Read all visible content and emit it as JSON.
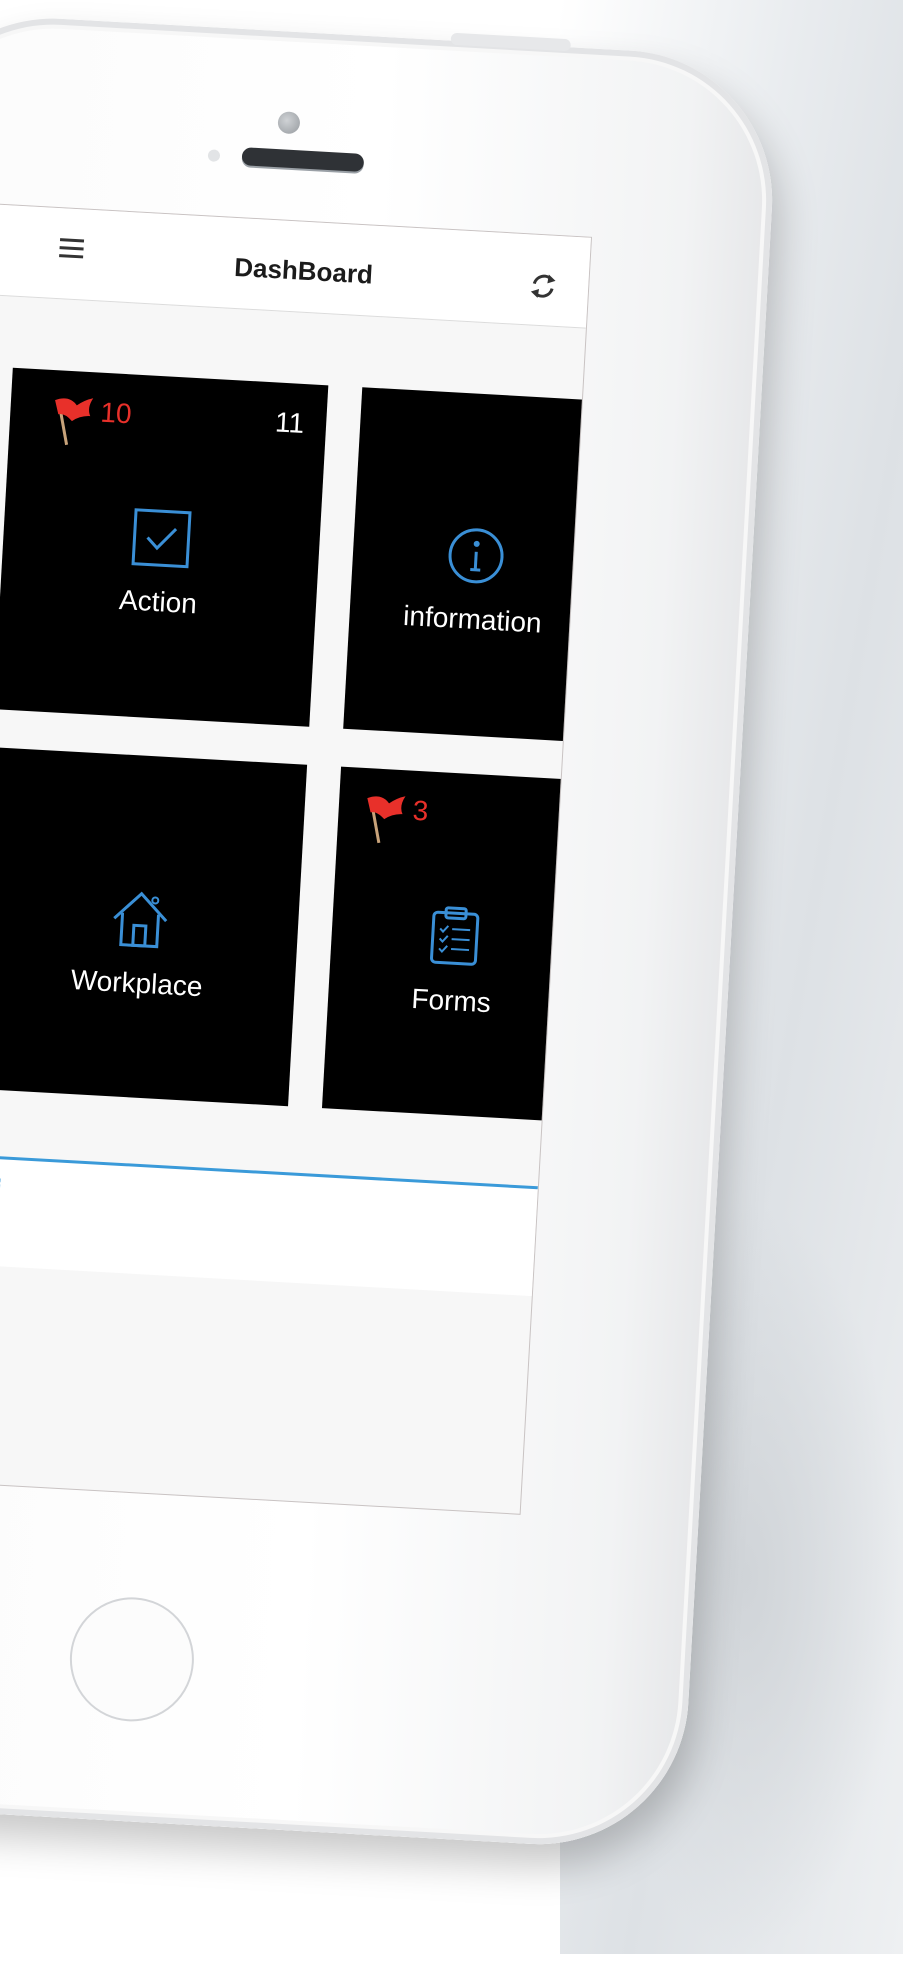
{
  "header": {
    "title": "DashBoard",
    "menu_icon": "hamburger-icon",
    "refresh_icon": "refresh-icon"
  },
  "tiles": [
    {
      "id": "action",
      "label": "Action",
      "icon": "checkbox-icon",
      "flag_count": "10",
      "total_count": "11"
    },
    {
      "id": "information",
      "label": "information",
      "icon": "info-icon"
    },
    {
      "id": "workplace",
      "label": "Workplace",
      "icon": "home-icon"
    },
    {
      "id": "forms",
      "label": "Forms",
      "icon": "clipboard-icon",
      "flag_count": "3"
    }
  ],
  "footer": {
    "brand_text": "E"
  },
  "colors": {
    "tile_background": "#000000",
    "icon_accent": "#3a8fd6",
    "flag_red": "#e8302a",
    "footer_line": "#3a9ad9"
  }
}
